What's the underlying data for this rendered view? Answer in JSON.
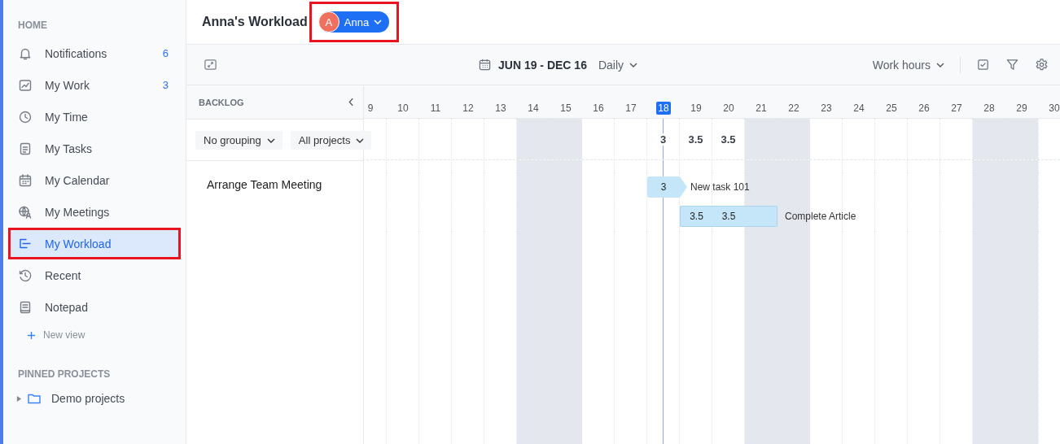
{
  "sidebar": {
    "home_title": "HOME",
    "items": [
      {
        "label": "Notifications",
        "count": "6",
        "selected": false,
        "highlighted": false
      },
      {
        "label": "My Work",
        "count": "3",
        "selected": false,
        "highlighted": false
      },
      {
        "label": "My Time",
        "selected": false,
        "highlighted": false
      },
      {
        "label": "My Tasks",
        "selected": false,
        "highlighted": false
      },
      {
        "label": "My Calendar",
        "selected": false,
        "highlighted": false
      },
      {
        "label": "My Meetings",
        "selected": false,
        "highlighted": false
      },
      {
        "label": "My Workload",
        "selected": true,
        "highlighted": true
      },
      {
        "label": "Recent",
        "selected": false,
        "highlighted": false
      },
      {
        "label": "Notepad",
        "selected": false,
        "highlighted": false
      }
    ],
    "add_view": "New view",
    "pinned_title": "PINNED PROJECTS",
    "projects": [
      {
        "label": "Demo projects",
        "expanded": false
      }
    ]
  },
  "header": {
    "title": "Anna's Workload",
    "user": {
      "initial": "A",
      "name": "Anna",
      "highlighted": true
    }
  },
  "toolbar": {
    "date_range": "JUN 19 - DEC 16",
    "scale": "Daily",
    "measure": "Work hours"
  },
  "backlog": {
    "title": "BACKLOG",
    "filters": [
      "No grouping",
      "All projects"
    ],
    "items": [
      "Arrange Team Meeting"
    ]
  },
  "timeline": {
    "days": [
      {
        "label": "9",
        "weekend": false,
        "today": false
      },
      {
        "label": "10",
        "weekend": false,
        "today": false
      },
      {
        "label": "11",
        "weekend": false,
        "today": false
      },
      {
        "label": "12",
        "weekend": false,
        "today": false
      },
      {
        "label": "13",
        "weekend": false,
        "today": false
      },
      {
        "label": "14",
        "weekend": true,
        "today": false
      },
      {
        "label": "15",
        "weekend": true,
        "today": false
      },
      {
        "label": "16",
        "weekend": false,
        "today": false
      },
      {
        "label": "17",
        "weekend": false,
        "today": false
      },
      {
        "label": "18",
        "weekend": false,
        "today": true,
        "total": "3"
      },
      {
        "label": "19",
        "weekend": false,
        "today": false,
        "total": "3.5"
      },
      {
        "label": "20",
        "weekend": false,
        "today": false,
        "total": "3.5"
      },
      {
        "label": "21",
        "weekend": true,
        "today": false
      },
      {
        "label": "22",
        "weekend": true,
        "today": false
      },
      {
        "label": "23",
        "weekend": false,
        "today": false
      },
      {
        "label": "24",
        "weekend": false,
        "today": false
      },
      {
        "label": "25",
        "weekend": false,
        "today": false
      },
      {
        "label": "26",
        "weekend": false,
        "today": false
      },
      {
        "label": "27",
        "weekend": false,
        "today": false
      },
      {
        "label": "28",
        "weekend": true,
        "today": false
      },
      {
        "label": "29",
        "weekend": true,
        "today": false
      },
      {
        "label": "30",
        "weekend": false,
        "today": false
      }
    ],
    "tasks": [
      {
        "name": "New task 101",
        "kind": "arrow",
        "cells": [
          {
            "bar": false
          },
          {
            "bar": false
          },
          {
            "bar": false
          },
          {
            "bar": false
          },
          {
            "bar": false
          },
          {
            "bar": false
          },
          {
            "bar": false
          },
          {
            "bar": false
          },
          {
            "bar": false
          },
          {
            "bar": true,
            "hours": "3"
          },
          {
            "bar": false
          },
          {
            "bar": false
          },
          {
            "bar": false
          },
          {
            "bar": false
          },
          {
            "bar": false
          },
          {
            "bar": false
          },
          {
            "bar": false
          },
          {
            "bar": false
          },
          {
            "bar": false
          },
          {
            "bar": false
          },
          {
            "bar": false
          },
          {
            "bar": false
          }
        ]
      },
      {
        "name": "Complete Article",
        "kind": "block",
        "cells": [
          {
            "bar": false
          },
          {
            "bar": false
          },
          {
            "bar": false
          },
          {
            "bar": false
          },
          {
            "bar": false
          },
          {
            "bar": false
          },
          {
            "bar": false
          },
          {
            "bar": false
          },
          {
            "bar": false
          },
          {
            "bar": false
          },
          {
            "bar": true,
            "hours": "3.5"
          },
          {
            "bar": true,
            "hours": "3.5"
          },
          {
            "bar": true
          },
          {
            "bar": false
          },
          {
            "bar": false
          },
          {
            "bar": false
          },
          {
            "bar": false
          },
          {
            "bar": false
          },
          {
            "bar": false
          },
          {
            "bar": false
          },
          {
            "bar": false
          },
          {
            "bar": false
          }
        ]
      }
    ]
  }
}
